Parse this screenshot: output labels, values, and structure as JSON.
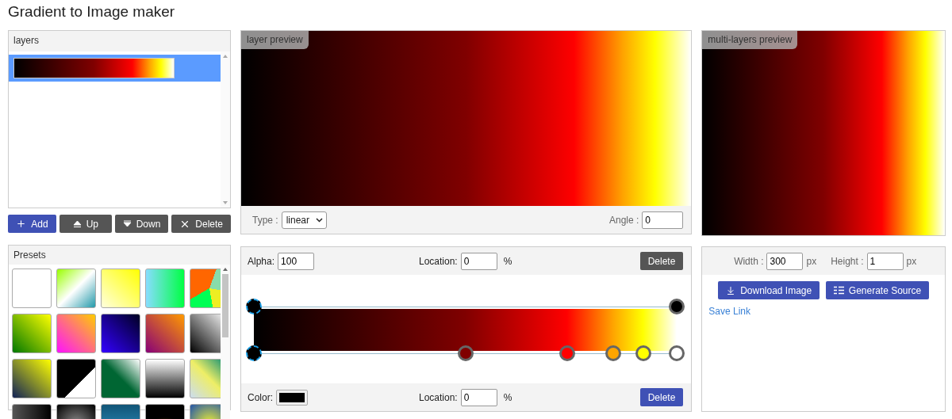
{
  "title": "Gradient to Image maker",
  "layers": {
    "header": "layers",
    "items": [
      {
        "selected": true
      }
    ],
    "buttons": [
      {
        "kind": "add",
        "label": "Add"
      },
      {
        "kind": "up",
        "label": "Up"
      },
      {
        "kind": "down",
        "label": "Down"
      },
      {
        "kind": "delete",
        "label": "Delete"
      }
    ]
  },
  "presets": {
    "header": "Presets"
  },
  "layer_preview": {
    "badge": "layer preview",
    "type_label": "Type :",
    "type_value": "linear",
    "angle_label": "Angle :",
    "angle_value": "0"
  },
  "editor": {
    "alpha_label": "Alpha:",
    "alpha_value": "100",
    "alpha_location_label": "Location:",
    "alpha_location_value": "0",
    "alpha_percent": "%",
    "alpha_delete": "Delete",
    "alpha_stops": [
      {
        "level": 0,
        "selected": true
      },
      {
        "level": 1,
        "selected": false
      }
    ],
    "color_stops": [
      {
        "level": 0,
        "color": "#000000",
        "selected": true
      },
      {
        "level": 0.5,
        "color": "#800000",
        "selected": false
      },
      {
        "level": 0.74,
        "color": "#ff0000",
        "selected": false
      },
      {
        "level": 0.85,
        "color": "#ffa500",
        "selected": false
      },
      {
        "level": 0.92,
        "color": "#ffff00",
        "selected": false
      },
      {
        "level": 1,
        "color": "#ffffff",
        "selected": false
      }
    ],
    "color_label": "Color:",
    "color_input": {
      "color": "#000000"
    },
    "color_location_label": "Location:",
    "color_location_value": "0",
    "color_percent": "%",
    "color_delete": "Delete"
  },
  "multi_preview": {
    "badge": "multi-layers preview"
  },
  "output": {
    "width_label": "Width :",
    "width_value": "300",
    "width_unit": "px",
    "height_label": "Height :",
    "height_value": "1",
    "height_unit": "px",
    "download": "Download Image",
    "generate": "Generate Source",
    "save_link": "Save Link"
  }
}
